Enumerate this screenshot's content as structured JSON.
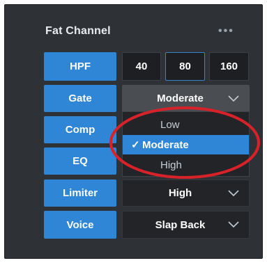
{
  "panel": {
    "title": "Fat Channel",
    "more_icon": "•••"
  },
  "hpf": {
    "label": "HPF",
    "options": [
      "40",
      "80",
      "160"
    ],
    "selected": "80"
  },
  "gate": {
    "label": "Gate",
    "value": "Moderate",
    "dropdown_open": true,
    "options": [
      {
        "label": "Low",
        "checked": false
      },
      {
        "label": "Moderate",
        "checked": true,
        "check_mark": "✓"
      },
      {
        "label": "High",
        "checked": false
      }
    ]
  },
  "comp": {
    "label": "Comp"
  },
  "eq": {
    "label": "EQ"
  },
  "limiter": {
    "label": "Limiter",
    "value": "High"
  },
  "voice": {
    "label": "Voice",
    "value": "Slap Back"
  },
  "colors": {
    "panel_bg": "#2e3135",
    "accent_blue": "#2f86d6",
    "annotation_red": "#d8222a"
  },
  "annotation": {
    "shape": "red-ellipse-highlight"
  }
}
